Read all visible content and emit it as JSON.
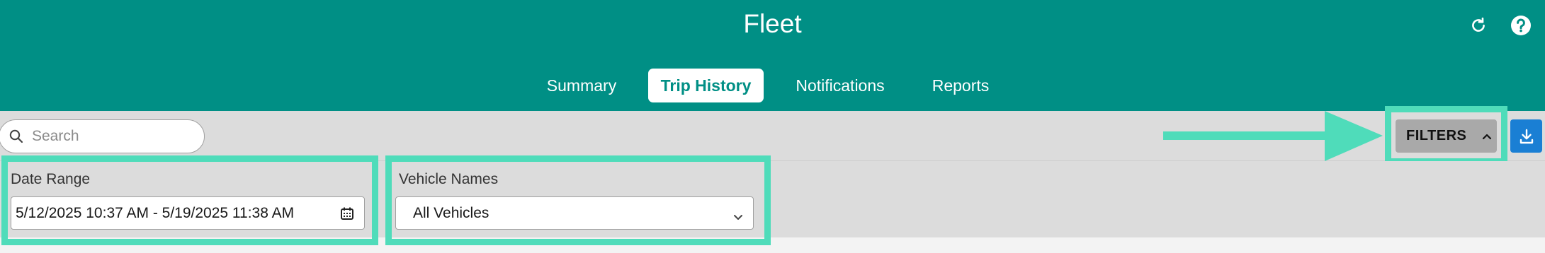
{
  "header": {
    "title": "Fleet",
    "icons": [
      "refresh-icon",
      "help-icon"
    ],
    "background_color": "#008f85"
  },
  "tabs": [
    {
      "label": "Summary",
      "active": false
    },
    {
      "label": "Trip History",
      "active": true
    },
    {
      "label": "Notifications",
      "active": false
    },
    {
      "label": "Reports",
      "active": false
    }
  ],
  "toolbar": {
    "search_placeholder": "Search",
    "filters_label": "FILTERS",
    "download_icon": "download-icon"
  },
  "filters": {
    "date_range": {
      "label": "Date Range",
      "value": "5/12/2025 10:37 AM - 5/19/2025 11:38 AM",
      "icon": "calendar-icon"
    },
    "vehicle_names": {
      "label": "Vehicle Names",
      "value": "All Vehicles",
      "icon": "chevron-down-icon"
    }
  },
  "annotation": {
    "highlight_color": "#4fdcba"
  }
}
